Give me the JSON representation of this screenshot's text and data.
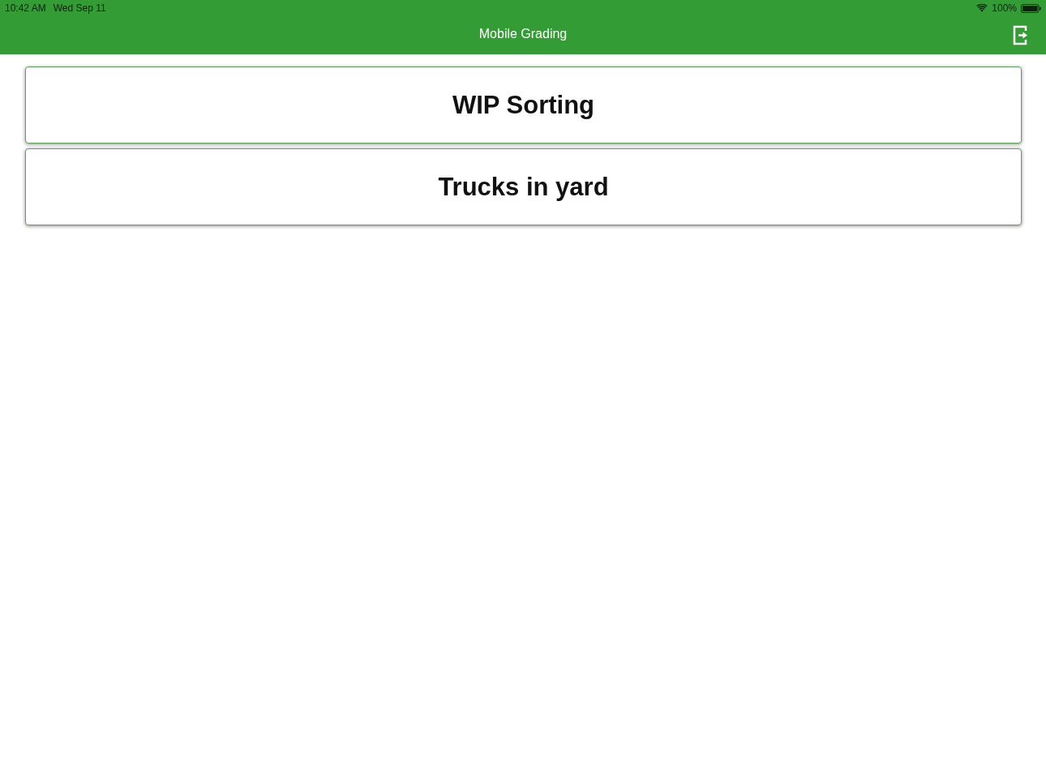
{
  "status_bar": {
    "time": "10:42 AM",
    "date": "Wed Sep 11",
    "battery": "100%"
  },
  "nav_bar": {
    "title": "Mobile Grading"
  },
  "menu_items": [
    {
      "label": "WIP Sorting"
    },
    {
      "label": "Trucks in yard"
    }
  ]
}
